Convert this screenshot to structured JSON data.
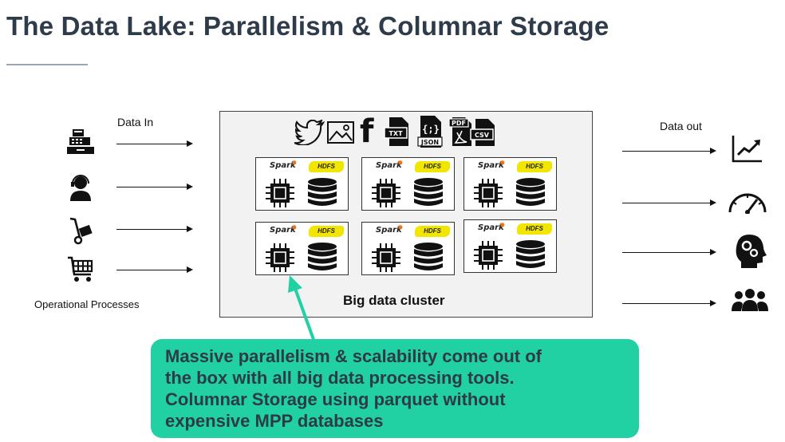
{
  "header": {
    "title": "The Data Lake: Parallelism & Columnar Storage"
  },
  "left": {
    "data_in_label": "Data In",
    "operational_label": "Operational Processes",
    "sources": [
      {
        "icon": "cash-register-icon"
      },
      {
        "icon": "customer-support-icon"
      },
      {
        "icon": "hand-truck-icon"
      },
      {
        "icon": "shopping-cart-icon"
      }
    ]
  },
  "right": {
    "data_out_label": "Data out",
    "outputs": [
      {
        "icon": "line-chart-icon"
      },
      {
        "icon": "gauge-icon"
      },
      {
        "icon": "head-gears-icon"
      },
      {
        "icon": "group-icon"
      }
    ]
  },
  "cluster": {
    "label": "Big data cluster",
    "formats": [
      {
        "icon": "twitter-icon",
        "text": ""
      },
      {
        "icon": "image-icon",
        "text": ""
      },
      {
        "icon": "facebook-icon",
        "text": "f"
      },
      {
        "icon": "txt-file-icon",
        "text": "TXT"
      },
      {
        "icon": "json-file-icon",
        "text": "JSON"
      },
      {
        "icon": "pdf-file-icon",
        "text": "PDF"
      },
      {
        "icon": "csv-file-icon",
        "text": "CSV"
      }
    ],
    "node": {
      "spark_label": "Spark",
      "hdfs_label": "HDFS"
    },
    "node_count": 6
  },
  "callout": {
    "text": "Massive parallelism &  scalability come out of\nthe box with all big data processing tools.\nColumnar Storage using parquet without\nexpensive MPP databases",
    "color": "#22d1a3"
  },
  "colors": {
    "title": "#2e3b4a",
    "hdfs_badge": "#f2e600",
    "spark_star": "#e8731a"
  }
}
